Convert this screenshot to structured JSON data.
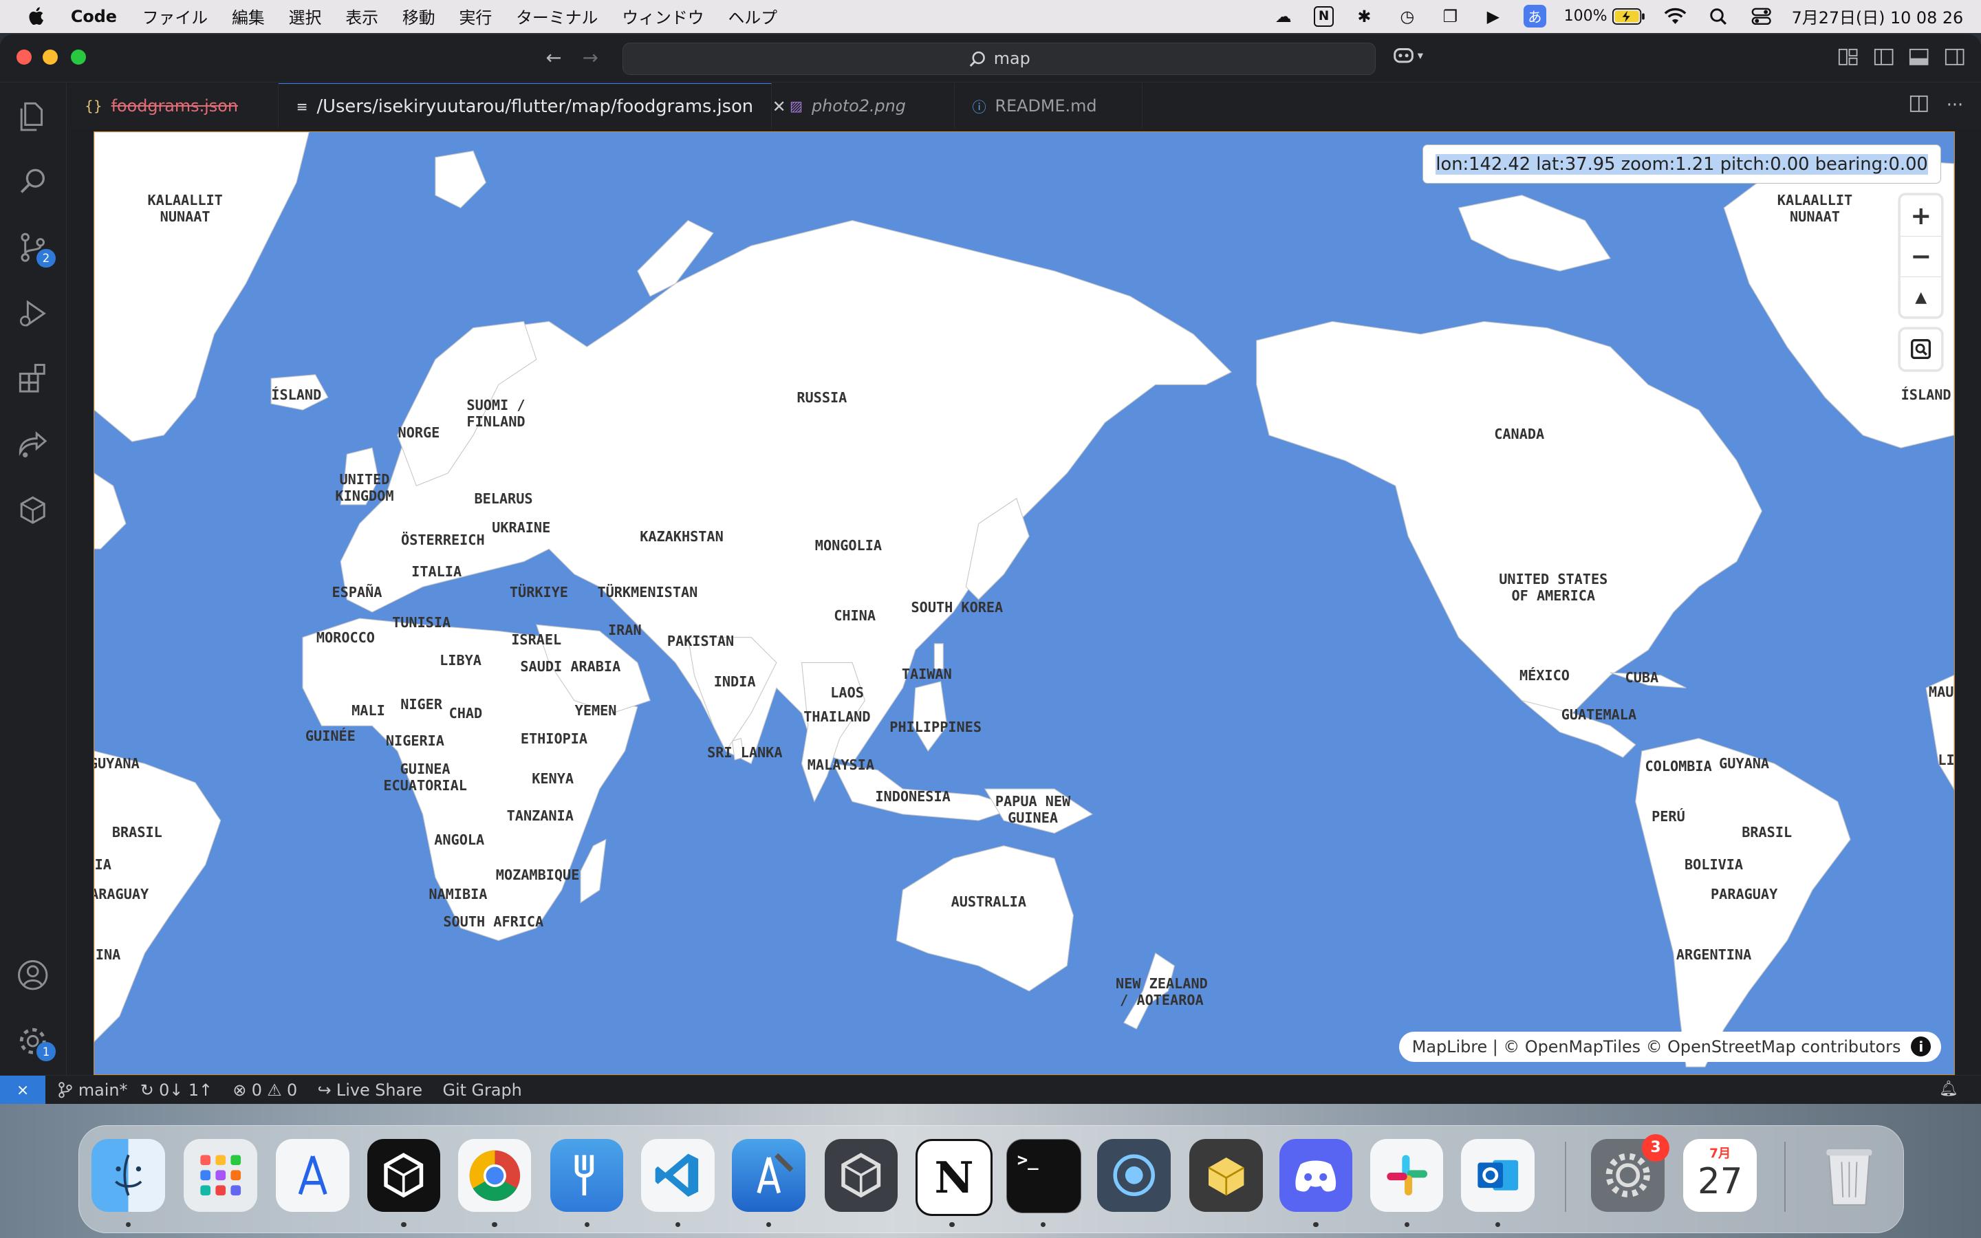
{
  "menubar": {
    "app_name": "Code",
    "items": [
      "ファイル",
      "編集",
      "選択",
      "表示",
      "移動",
      "実行",
      "ターミナル",
      "ウィンドウ",
      "ヘルプ"
    ],
    "battery": "100%",
    "ime": "あ",
    "datetime": "7月27日(日) 10 08 26"
  },
  "titlebar": {
    "search_text": "map"
  },
  "activity": {
    "scm_badge": "2",
    "settings_badge": "1"
  },
  "tabs": [
    {
      "label": "foodgrams.json",
      "icon": "{}"
    },
    {
      "label": "/Users/isekiryuutarou/flutter/map/foodgrams.json",
      "icon": "≡"
    },
    {
      "label": "photo2.png",
      "icon": "▨"
    },
    {
      "label": "README.md",
      "icon": "ⓘ"
    }
  ],
  "map": {
    "coord_readout": "lon:142.42 lat:37.95 zoom:1.21 pitch:0.00 bearing:0.00",
    "zoom_in": "+",
    "zoom_out": "−",
    "compass": "▲",
    "attribution": "MapLibre | © OpenMapTiles © OpenStreetMap contributors",
    "info": "i",
    "water_color": "#5b8fdc",
    "land_color": "#ffffff",
    "labels": [
      "KALAALLIT\nNUNAAT",
      "ÍSLAND",
      "NORGE",
      "SUOMI /\nFINLAND",
      "UNITED\nKINGDOM",
      "BELARUS",
      "UKRAINE",
      "ÖSTERREICH",
      "ITALIA",
      "ESPAÑA",
      "TÜRKIYE",
      "TUNISIA",
      "MOROCCO",
      "LIBYA",
      "ISRAEL",
      "SAUDI ARABIA",
      "IRAN",
      "TÜRKMENISTAN",
      "KAZAKHSTAN",
      "RUSSIA",
      "MONGOLIA",
      "CHINA",
      "SOUTH KOREA",
      "PAKISTAN",
      "INDIA",
      "SRI LANKA",
      "LAOS",
      "THAILAND",
      "TAIWAN",
      "PHILIPPINES",
      "MALAYSIA",
      "INDONESIA",
      "PAPUA NEW\nGUINEA",
      "AUSTRALIA",
      "NEW ZEALAND\n/ AOTEAROA",
      "YEMEN",
      "ETHIOPIA",
      "KENYA",
      "TANZANIA",
      "ANGOLA",
      "NAMIBIA",
      "MOZAMBIQUE",
      "SOUTH AFRICA",
      "MALI",
      "NIGER",
      "CHAD",
      "NIGERIA",
      "GUINÉE",
      "GUINEA\nECUATORIAL",
      "GUYANA",
      "BRASIL",
      "IA",
      "ARAGUAY",
      "INA",
      "KALAALLIT\nNUNAAT",
      "ÍSLAND",
      "CANADA",
      "UNITED STATES\nOF AMERICA",
      "MÉXICO",
      "CUBA",
      "GUATEMALA",
      "COLOMBIA",
      "GUYANA",
      "PERÚ",
      "BRASIL",
      "BOLIVIA",
      "PARAGUAY",
      "ARGENTINA",
      "MAU",
      "LI"
    ]
  },
  "statusbar": {
    "branch": "main*",
    "sync": "0↓ 1↑",
    "problems": "0",
    "warnings": "0",
    "live_share": "Live Share",
    "git_graph": "Git Graph"
  },
  "dock": {
    "settings_badge": "3",
    "calendar_month": "7月",
    "calendar_day": "27"
  }
}
